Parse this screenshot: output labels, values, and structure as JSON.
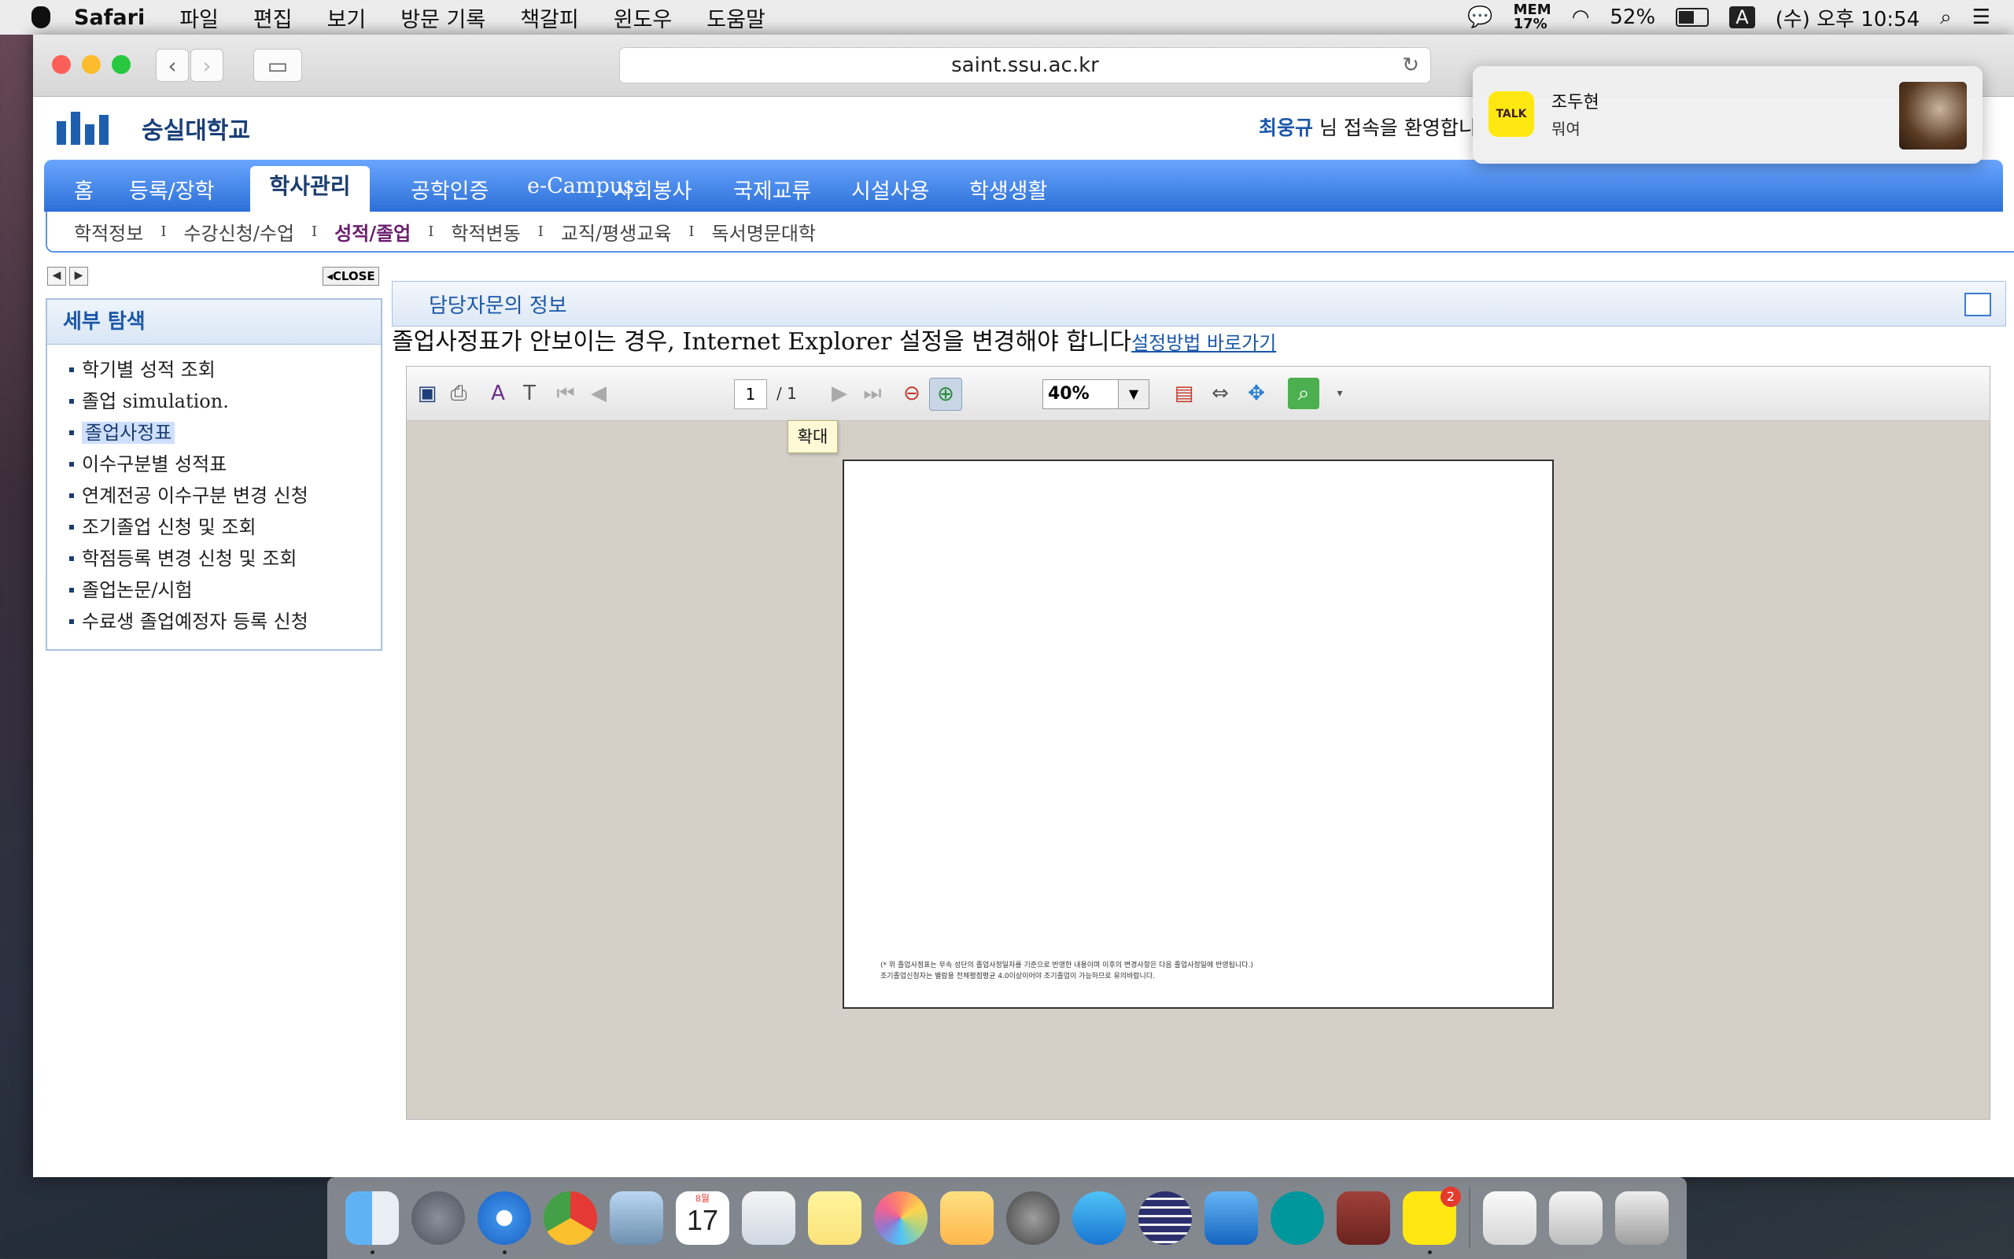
{
  "menubar": {
    "app": "Safari",
    "items": [
      "파일",
      "편집",
      "보기",
      "방문 기록",
      "책갈피",
      "윈도우",
      "도움말"
    ],
    "mem_label": "MEM",
    "mem_value": "17%",
    "battery": "52%",
    "input_method": "A",
    "clock": "(수) 오후 10:54"
  },
  "browser": {
    "url": "saint.ssu.ac.kr"
  },
  "site": {
    "logo_text": "숭실대학교",
    "welcome_name": "최웅규",
    "welcome_text": "님 접속을 환영합니",
    "gnb": [
      "홈",
      "등록/장학",
      "학사관리",
      "공학인증",
      "e-Campus",
      "사회봉사",
      "국제교류",
      "시설사용",
      "학생생활"
    ],
    "lnb": [
      "학적정보",
      "수강신청/수업",
      "성적/졸업",
      "학적변동",
      "교직/평생교육",
      "독서명문대학"
    ],
    "close_label": "CLOSE",
    "sidebar_title": "세부 탐색",
    "sidebar_items": [
      "학기별 성적 조회",
      "졸업 simulation.",
      "졸업사정표",
      "이수구분별 성적표",
      "연계전공 이수구분 변경 신청",
      "조기졸업 신청 및 조회",
      "학점등록 변경 신청 및 조회",
      "졸업논문/시험",
      "수료생 졸업예정자 등록 신청"
    ],
    "info_title": "담당자문의 정보",
    "notice_text": "졸업사정표가 안보이는 경우, Internet Explorer 설정을 변경해야 합니다",
    "notice_link": "설정방법 바로가기"
  },
  "viewer": {
    "page_current": "1",
    "page_total": "/ 1",
    "zoom": "40%",
    "tooltip": "확대",
    "footnote_1": "(* 위 졸업사정표는 무속 성단의 졸업사정일자를 기준으로 반영한 내용이며 이후의 변경사항은 다음 졸업사정일에 반영됩니다.)",
    "footnote_2": "조기졸업신청자는 별람용 전체평점평균 4.0이상이어야 조기졸업이 가능하므로 유의바랍니다."
  },
  "notification": {
    "app_icon": "TALK",
    "sender": "조두현",
    "message": "뭐여"
  },
  "dock": {
    "talk_badge": "2",
    "calendar_month": "8월",
    "calendar_day": "17"
  }
}
